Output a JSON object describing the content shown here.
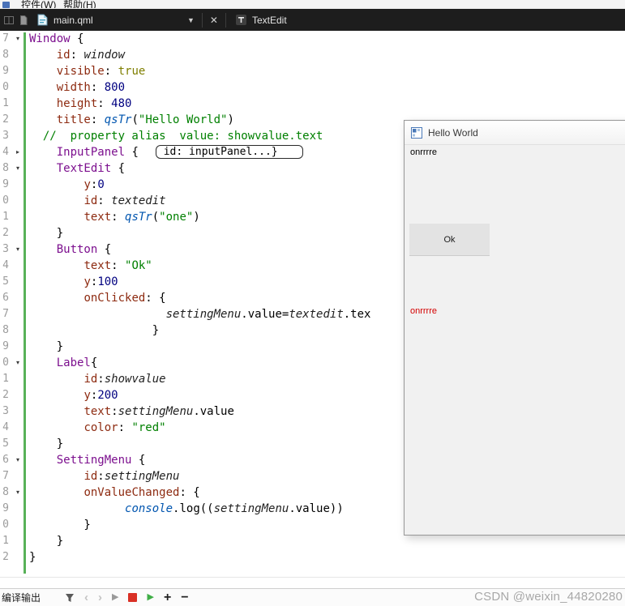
{
  "menubar": {
    "items": [
      {
        "label": "控件(W)"
      },
      {
        "label": "帮助(H)"
      }
    ]
  },
  "tabbar": {
    "tabs": [
      {
        "label": "main.qml"
      },
      {
        "label": "TextEdit"
      }
    ],
    "dropdown_icon": "▼",
    "close_icon": "✕"
  },
  "editor": {
    "lines": [
      {
        "n": "7",
        "fold": "open",
        "tokens": [
          [
            "type",
            "Window"
          ],
          [
            "plain",
            " {"
          ]
        ]
      },
      {
        "n": "8",
        "tokens": [
          [
            "plain",
            "    "
          ],
          [
            "prop",
            "id"
          ],
          [
            "plain",
            ": "
          ],
          [
            "id",
            "window"
          ]
        ]
      },
      {
        "n": "9",
        "tokens": [
          [
            "plain",
            "    "
          ],
          [
            "prop",
            "visible"
          ],
          [
            "plain",
            ": "
          ],
          [
            "kw",
            "true"
          ]
        ]
      },
      {
        "n": "0",
        "tokens": [
          [
            "plain",
            "    "
          ],
          [
            "prop",
            "width"
          ],
          [
            "plain",
            ": "
          ],
          [
            "num",
            "800"
          ]
        ]
      },
      {
        "n": "1",
        "tokens": [
          [
            "plain",
            "    "
          ],
          [
            "prop",
            "height"
          ],
          [
            "plain",
            ": "
          ],
          [
            "num",
            "480"
          ]
        ]
      },
      {
        "n": "2",
        "tokens": [
          [
            "plain",
            "    "
          ],
          [
            "prop",
            "title"
          ],
          [
            "plain",
            ": "
          ],
          [
            "func",
            "qsTr"
          ],
          [
            "plain",
            "("
          ],
          [
            "str",
            "\"Hello World\""
          ],
          [
            "plain",
            ")"
          ]
        ]
      },
      {
        "n": "3",
        "tokens": [
          [
            "plain",
            "  "
          ],
          [
            "comment",
            "//  property alias  value: showvalue.text"
          ]
        ]
      },
      {
        "n": "4",
        "fold": "collapsed",
        "tokens": [
          [
            "plain",
            "    "
          ],
          [
            "type",
            "InputPanel"
          ],
          [
            "plain",
            " {  "
          ],
          [
            "foldbox",
            "id: inputPanel...}"
          ]
        ]
      },
      {
        "n": "8",
        "fold": "open",
        "tokens": [
          [
            "plain",
            "    "
          ],
          [
            "type",
            "TextEdit"
          ],
          [
            "plain",
            " {"
          ]
        ]
      },
      {
        "n": "9",
        "tokens": [
          [
            "plain",
            "        "
          ],
          [
            "prop",
            "y"
          ],
          [
            "plain",
            ":"
          ],
          [
            "num",
            "0"
          ]
        ]
      },
      {
        "n": "0",
        "tokens": [
          [
            "plain",
            "        "
          ],
          [
            "prop",
            "id"
          ],
          [
            "plain",
            ": "
          ],
          [
            "id",
            "textedit"
          ]
        ]
      },
      {
        "n": "1",
        "tokens": [
          [
            "plain",
            "        "
          ],
          [
            "prop",
            "text"
          ],
          [
            "plain",
            ": "
          ],
          [
            "func",
            "qsTr"
          ],
          [
            "plain",
            "("
          ],
          [
            "str",
            "\"one\""
          ],
          [
            "plain",
            ")"
          ]
        ]
      },
      {
        "n": "2",
        "tokens": [
          [
            "plain",
            "    }"
          ]
        ]
      },
      {
        "n": "3",
        "fold": "open",
        "tokens": [
          [
            "plain",
            "    "
          ],
          [
            "type",
            "Button"
          ],
          [
            "plain",
            " {"
          ]
        ]
      },
      {
        "n": "4",
        "tokens": [
          [
            "plain",
            "        "
          ],
          [
            "prop",
            "text"
          ],
          [
            "plain",
            ": "
          ],
          [
            "str",
            "\"Ok\""
          ]
        ]
      },
      {
        "n": "5",
        "tokens": [
          [
            "plain",
            "        "
          ],
          [
            "prop",
            "y"
          ],
          [
            "plain",
            ":"
          ],
          [
            "num",
            "100"
          ]
        ]
      },
      {
        "n": "6",
        "tokens": [
          [
            "plain",
            "        "
          ],
          [
            "prop",
            "onClicked"
          ],
          [
            "plain",
            ": {"
          ]
        ]
      },
      {
        "n": "7",
        "tokens": [
          [
            "plain",
            "                    "
          ],
          [
            "id",
            "settingMenu"
          ],
          [
            "plain",
            ".value="
          ],
          [
            "id",
            "textedit"
          ],
          [
            "plain",
            ".tex"
          ]
        ]
      },
      {
        "n": "8",
        "tokens": [
          [
            "plain",
            "                  }"
          ]
        ]
      },
      {
        "n": "9",
        "tokens": [
          [
            "plain",
            "    }"
          ]
        ]
      },
      {
        "n": "0",
        "fold": "open",
        "tokens": [
          [
            "plain",
            "    "
          ],
          [
            "type",
            "Label"
          ],
          [
            "plain",
            "{"
          ]
        ]
      },
      {
        "n": "1",
        "tokens": [
          [
            "plain",
            "        "
          ],
          [
            "prop",
            "id"
          ],
          [
            "plain",
            ":"
          ],
          [
            "id",
            "showvalue"
          ]
        ]
      },
      {
        "n": "2",
        "tokens": [
          [
            "plain",
            "        "
          ],
          [
            "prop",
            "y"
          ],
          [
            "plain",
            ":"
          ],
          [
            "num",
            "200"
          ]
        ]
      },
      {
        "n": "3",
        "tokens": [
          [
            "plain",
            "        "
          ],
          [
            "prop",
            "text"
          ],
          [
            "plain",
            ":"
          ],
          [
            "id",
            "settingMenu"
          ],
          [
            "plain",
            ".value"
          ]
        ]
      },
      {
        "n": "4",
        "tokens": [
          [
            "plain",
            "        "
          ],
          [
            "prop",
            "color"
          ],
          [
            "plain",
            ": "
          ],
          [
            "str",
            "\"red\""
          ]
        ]
      },
      {
        "n": "5",
        "tokens": [
          [
            "plain",
            "    }"
          ]
        ]
      },
      {
        "n": "6",
        "fold": "open",
        "tokens": [
          [
            "plain",
            "    "
          ],
          [
            "type",
            "SettingMenu"
          ],
          [
            "plain",
            " {"
          ]
        ]
      },
      {
        "n": "7",
        "tokens": [
          [
            "plain",
            "        "
          ],
          [
            "prop",
            "id"
          ],
          [
            "plain",
            ":"
          ],
          [
            "id",
            "settingMenu"
          ]
        ]
      },
      {
        "n": "8",
        "fold": "open",
        "tokens": [
          [
            "plain",
            "        "
          ],
          [
            "prop",
            "onValueChanged"
          ],
          [
            "plain",
            ": {"
          ]
        ]
      },
      {
        "n": "9",
        "tokens": [
          [
            "plain",
            "              "
          ],
          [
            "func",
            "console"
          ],
          [
            "plain",
            ".log(("
          ],
          [
            "id",
            "settingMenu"
          ],
          [
            "plain",
            ".value))"
          ]
        ]
      },
      {
        "n": "0",
        "tokens": [
          [
            "plain",
            "        }"
          ]
        ]
      },
      {
        "n": "1",
        "tokens": [
          [
            "plain",
            "    }"
          ]
        ]
      },
      {
        "n": "2",
        "tokens": [
          [
            "plain",
            "}"
          ]
        ]
      }
    ]
  },
  "preview_window": {
    "title": "Hello World",
    "textedit_text": "onrrrre",
    "button_label": "Ok",
    "label_text": "onrrrre",
    "label_color": "#d40000"
  },
  "statusbar": {
    "pane_label": "编译输出"
  },
  "watermark": "CSDN @weixin_44820280",
  "colors": {
    "tabbar_bg": "#1d1d1d",
    "change_bar_green": "#58b158",
    "stop_icon_red": "#d93025",
    "run_icon_green": "#3fae46",
    "syntax_type_purple": "#7c0f8e",
    "syntax_property_red": "#8d2a10",
    "syntax_string_green": "#008000",
    "syntax_number_navy": "#000080"
  }
}
